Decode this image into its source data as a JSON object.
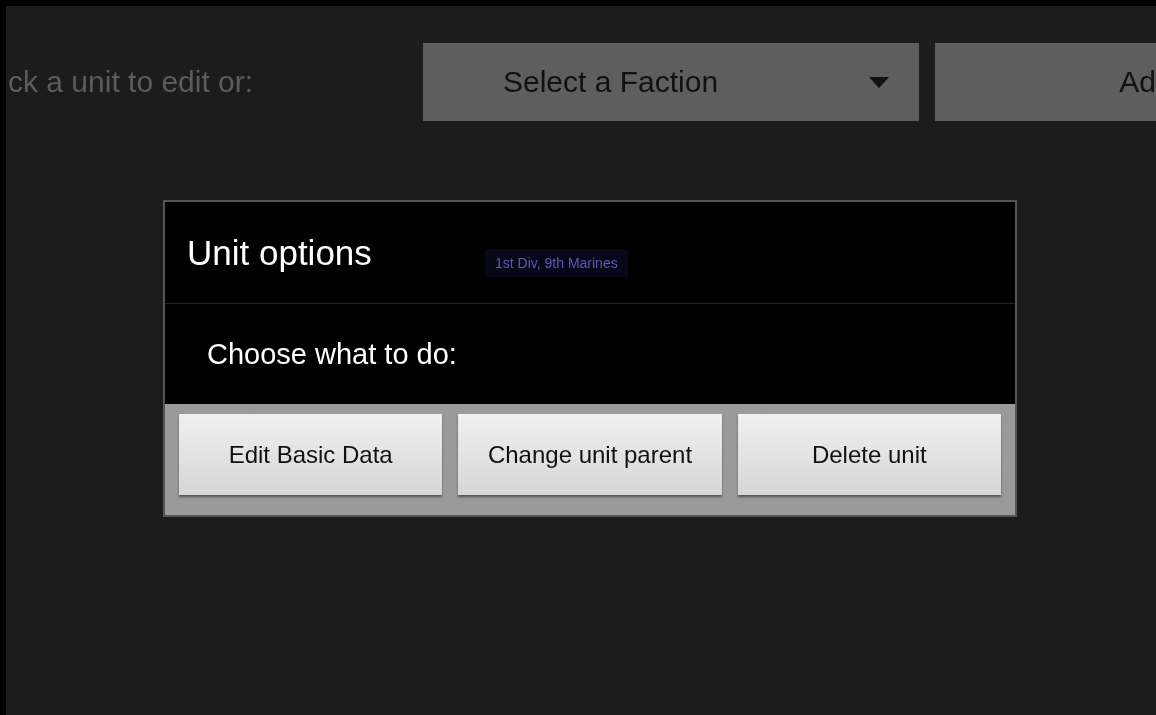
{
  "toolbar": {
    "label": "ck a unit to edit or:",
    "faction_dropdown": {
      "value": "Select a Faction"
    },
    "add_button": "Ad"
  },
  "background_unit": {
    "label": "1st Div, 9th Marines"
  },
  "dialog": {
    "title": "Unit options",
    "message": "Choose what to do:",
    "buttons": [
      "Edit Basic Data",
      "Change unit parent",
      "Delete unit"
    ]
  }
}
